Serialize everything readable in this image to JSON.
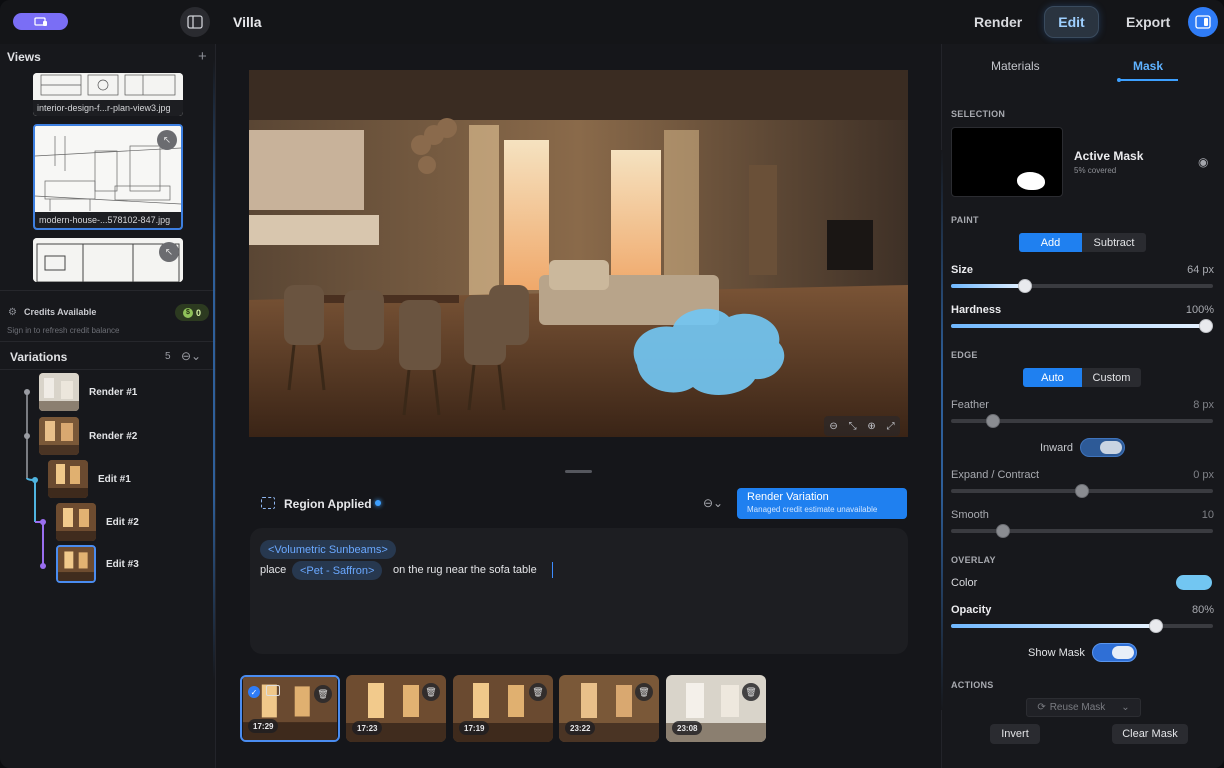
{
  "header": {
    "project_title": "Villa",
    "modes": [
      {
        "label": "Render"
      },
      {
        "label": "Edit",
        "active": true
      },
      {
        "label": "Export"
      }
    ]
  },
  "views": {
    "title": "Views",
    "items": [
      {
        "label": "interior-design-f...r-plan-view3.jpg"
      },
      {
        "label": "modern-house-...578102-847.jpg",
        "selected": true
      },
      {
        "label": ""
      }
    ]
  },
  "credits": {
    "label": "Credits Available",
    "sub": "Sign in to refresh credit balance",
    "count": "0"
  },
  "variations": {
    "title": "Variations",
    "count": "5",
    "items": [
      {
        "label": "Render #1"
      },
      {
        "label": "Render #2"
      },
      {
        "label": "Edit #1"
      },
      {
        "label": "Edit #2"
      },
      {
        "label": "Edit #3",
        "active": true
      }
    ]
  },
  "editor": {
    "region_label": "Region Applied",
    "render_button": {
      "title": "Render Variation",
      "sub": "Managed credit estimate unavailable"
    },
    "prompt": {
      "tag_1": "<Volumetric Sunbeams>",
      "word_1": "place",
      "tag_2": "<Pet - Saffron>",
      "word_2": "on the rug near the sofa table"
    },
    "strip": [
      {
        "time": "17:29",
        "selected": true
      },
      {
        "time": "17:23"
      },
      {
        "time": "17:19"
      },
      {
        "time": "23:22"
      },
      {
        "time": "23:08"
      }
    ]
  },
  "panel": {
    "tabs": [
      {
        "label": "Materials"
      },
      {
        "label": "Mask",
        "active": true
      }
    ],
    "selection": {
      "section": "SELECTION",
      "title": "Active Mask",
      "sub": "5% covered"
    },
    "paint": {
      "section": "PAINT",
      "mode_add": "Add",
      "mode_subtract": "Subtract",
      "size_label": "Size",
      "size_value": "64 px",
      "size_level": 0.27,
      "hardness_label": "Hardness",
      "hardness_value": "100%",
      "hardness_level": 1.0
    },
    "edge": {
      "section": "EDGE",
      "mode_auto": "Auto",
      "mode_custom": "Custom",
      "feather_label": "Feather",
      "feather_value": "8 px",
      "feather_level": 0.14,
      "inward_label": "Inward",
      "expand_label": "Expand / Contract",
      "expand_value": "0 px",
      "expand_level": 0.5,
      "smooth_label": "Smooth",
      "smooth_value": "10",
      "smooth_level": 0.18
    },
    "overlay": {
      "section": "OVERLAY",
      "color_label": "Color",
      "color": "#72c6f2",
      "opacity_label": "Opacity",
      "opacity_value": "80%",
      "opacity_level": 0.8,
      "show_mask_label": "Show Mask"
    },
    "actions": {
      "section": "ACTIONS",
      "reuse_label": "Reuse Mask",
      "invert_label": "Invert",
      "clear_label": "Clear Mask"
    }
  },
  "colors": {
    "accent": "#1f80f0",
    "mask_overlay": "#72c6f2"
  }
}
